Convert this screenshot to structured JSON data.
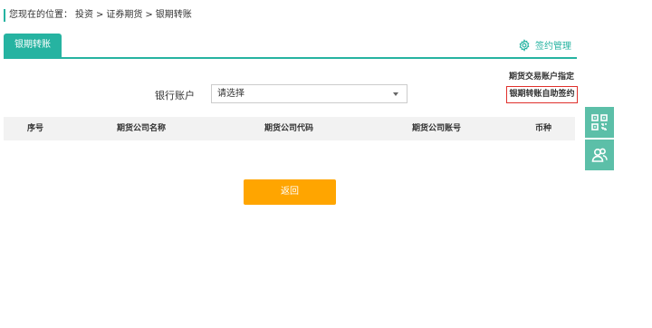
{
  "breadcrumb": {
    "prefix": "您现在的位置：",
    "items": [
      "投资",
      ">",
      "证券期货",
      ">",
      "银期转账"
    ]
  },
  "tabs": {
    "active_label": "银期转账"
  },
  "sign_management": {
    "label": "签约管理",
    "icon": "gear-icon"
  },
  "links": {
    "designate_account": "期货交易账户指定",
    "self_sign": "银期转账自助签约"
  },
  "form": {
    "bank_account_label": "银行账户",
    "bank_account_value": "请选择"
  },
  "table": {
    "headers": [
      "序号",
      "期货公司名称",
      "期货公司代码",
      "期货公司账号",
      "币种"
    ],
    "rows": []
  },
  "buttons": {
    "back": "返回"
  },
  "float_bar": {
    "icons": [
      "qr-code-icon",
      "customer-service-icon"
    ]
  },
  "colors": {
    "accent": "#26b3a1",
    "button": "#ffa500",
    "float_bar": "#5cbfa8",
    "highlight_border": "#e0302c"
  }
}
